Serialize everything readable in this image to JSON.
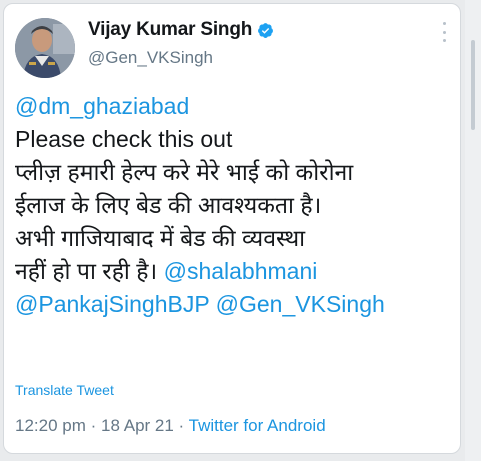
{
  "tweet": {
    "author": {
      "display_name": "Vijay Kumar Singh",
      "handle": "@Gen_VKSingh",
      "verified": true,
      "avatar_icon": "profile-photo"
    },
    "body": {
      "line1_mention": "@dm_ghaziabad",
      "line2": "Please check this out",
      "line3": "प्लीज़ हमारी हेल्प करे मेरे भाई को कोरोना",
      "line4": "ईलाज के लिए बेड की आवश्यकता है।",
      "line5": "अभी गाजियाबाद में बेड की व्यवस्था",
      "line6_text": "नहीं हो पा रही है।",
      "line6_mention": "@shalabhmani",
      "line7_mention1": "@PankajSinghBJP",
      "line7_mention2": "@Gen_VKSingh"
    },
    "translate_label": "Translate Tweet",
    "time": "12:20 pm",
    "separator1": "·",
    "date": "18 Apr 21",
    "separator2": "·",
    "source": "Twitter for Android"
  },
  "colors": {
    "link": "#1b95e0",
    "text": "#14171a",
    "muted": "#657786",
    "verified_badge": "#1da1f2"
  },
  "icons": {
    "verified": "verified-badge-icon",
    "more": "more-options-icon"
  }
}
